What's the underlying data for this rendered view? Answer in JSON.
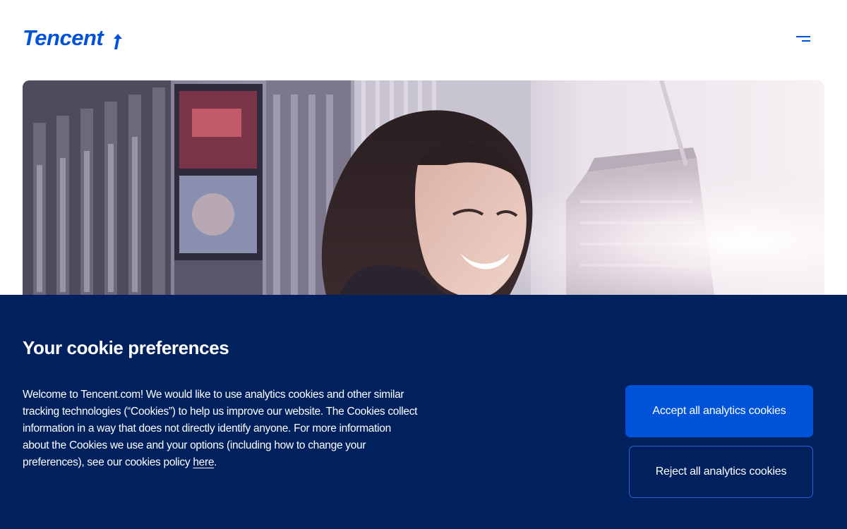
{
  "header": {
    "logo_text": "Tencent",
    "brand_color": "#0052d9",
    "menu_icon": "hamburger-menu-icon"
  },
  "hero": {
    "image_description_icon": "hero-photo"
  },
  "cookie_banner": {
    "background_color": "#00205e",
    "title": "Your cookie preferences",
    "body_text": "Welcome to Tencent.com! We would like to use analytics cookies and other similar tracking technologies (“Cookies”) to help us improve our website. The Cookies collect information in a way that does not directly identify anyone. For more information about the Cookies we use and your options (including how to change your preferences), see our cookies policy ",
    "link_text": "here",
    "trailing_text": ".",
    "accept_label": "Accept all analytics cookies",
    "reject_label": "Reject all analytics cookies"
  }
}
